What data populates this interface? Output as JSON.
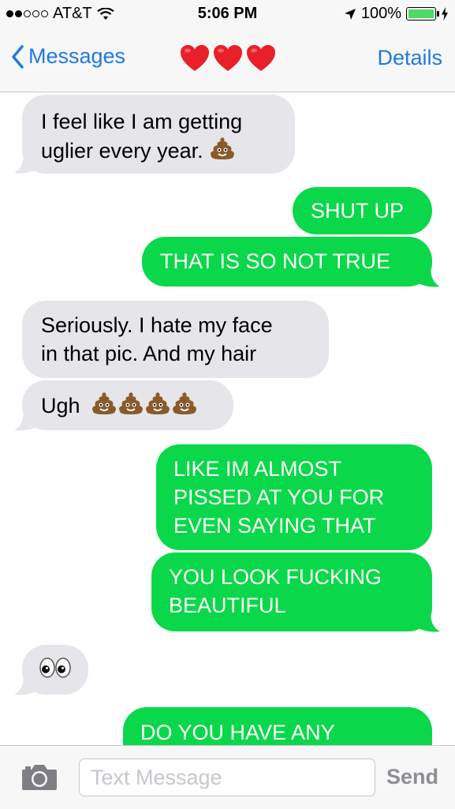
{
  "status_bar": {
    "carrier": "AT&T",
    "time": "5:06 PM",
    "battery": "100%",
    "signal_bars_filled": 2,
    "signal_bars_total": 5
  },
  "nav": {
    "back_label": "Messages",
    "title_emoji": "heart-heart-heart",
    "details_label": "Details"
  },
  "messages": [
    {
      "side": "received",
      "lines": [
        "I feel like I am getting",
        "uglier every year."
      ],
      "emoji": "poop"
    },
    {
      "side": "sent",
      "lines": [
        "SHUT UP"
      ]
    },
    {
      "side": "sent",
      "lines": [
        "THAT IS SO NOT TRUE"
      ]
    },
    {
      "side": "received",
      "lines": [
        "Seriously. I hate my face",
        "in that pic. And my hair"
      ]
    },
    {
      "side": "received",
      "lines": [
        "Ugh"
      ],
      "emoji": "poop x4"
    },
    {
      "side": "sent",
      "lines": [
        "LIKE IM ALMOST",
        "PISSED AT YOU FOR",
        "EVEN SAYING THAT"
      ]
    },
    {
      "side": "sent",
      "lines": [
        "YOU LOOK FUCKING",
        "BEAUTIFUL"
      ]
    },
    {
      "side": "received",
      "lines": [],
      "emoji": "eyes"
    },
    {
      "side": "sent",
      "lines": [
        "DO YOU HAVE ANY"
      ]
    }
  ],
  "input": {
    "placeholder": "Text Message",
    "send_label": "Send"
  },
  "colors": {
    "ios_blue": "#1f7ae0",
    "sent_bubble": "#0ad84a",
    "received_bubble": "#e5e5ea",
    "battery_green": "#4cd964"
  }
}
